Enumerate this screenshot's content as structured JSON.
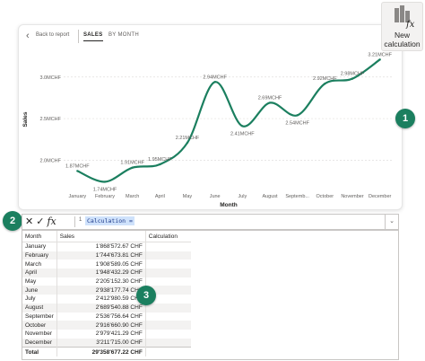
{
  "report": {
    "back_label": "Back to report",
    "tabs": [
      {
        "label": "SALES",
        "active": true
      },
      {
        "label": "BY MONTH",
        "active": false
      }
    ]
  },
  "ribbon": {
    "new_calculation_label_line1": "New",
    "new_calculation_label_line2": "calculation",
    "icon": "fx-table-icon"
  },
  "badges": [
    "1",
    "2",
    "3"
  ],
  "accent_colors": {
    "line": "#1b7f5f",
    "badge": "#1b7f5f",
    "highlight": "#cfe2fb"
  },
  "chart_data": {
    "type": "line",
    "xlabel": "Month",
    "ylabel": "Sales",
    "categories": [
      "January",
      "February",
      "March",
      "April",
      "May",
      "June",
      "July",
      "August",
      "Septemb...",
      "October",
      "November",
      "December"
    ],
    "series": [
      {
        "values": [
          1.87,
          1.74,
          1.91,
          1.95,
          2.21,
          2.94,
          2.41,
          2.69,
          2.54,
          2.92,
          2.98,
          3.21
        ]
      }
    ],
    "data_labels": [
      "1.87MCHF",
      "1.74MCHF",
      "1.91MCHF",
      "1.95MCHF",
      "2.21MCHF",
      "2.94MCHF",
      "2.41MCHF",
      "2.69MCHF",
      "2.54MCHF",
      "2.92MCHF",
      "2.98MCHF",
      "3.21MCHF"
    ],
    "yticks": [
      {
        "value": 2.0,
        "label": "2.0MCHF"
      },
      {
        "value": 2.5,
        "label": "2.5MCHF"
      },
      {
        "value": 3.0,
        "label": "3.0MCHF"
      }
    ],
    "ylim": [
      1.68,
      3.3
    ],
    "grid": true,
    "smooth": true
  },
  "formula_bar": {
    "icons": [
      "cancel-x-icon",
      "check-icon",
      "fx-icon"
    ],
    "line_number": "1",
    "expression": "Calculation =",
    "expand_icon": "chevron-down-icon"
  },
  "table": {
    "headers": [
      "Month",
      "Sales",
      "Calculation"
    ],
    "rows": [
      [
        "January",
        "1'868'572.67 CHF",
        ""
      ],
      [
        "February",
        "1'744'673.81 CHF",
        ""
      ],
      [
        "March",
        "1'908'589.05 CHF",
        ""
      ],
      [
        "April",
        "1'948'432.29 CHF",
        ""
      ],
      [
        "May",
        "2'205'152.30 CHF",
        ""
      ],
      [
        "June",
        "2'938'177.74 CHF",
        ""
      ],
      [
        "July",
        "2'412'980.59 CHF",
        ""
      ],
      [
        "August",
        "2'689'540.88 CHF",
        ""
      ],
      [
        "September",
        "2'536'756.64 CHF",
        ""
      ],
      [
        "October",
        "2'916'660.90 CHF",
        ""
      ],
      [
        "November",
        "2'979'421.29 CHF",
        ""
      ],
      [
        "December",
        "3'211'715.00 CHF",
        ""
      ]
    ],
    "total": [
      "Total",
      "29'358'677.22 CHF",
      ""
    ]
  }
}
